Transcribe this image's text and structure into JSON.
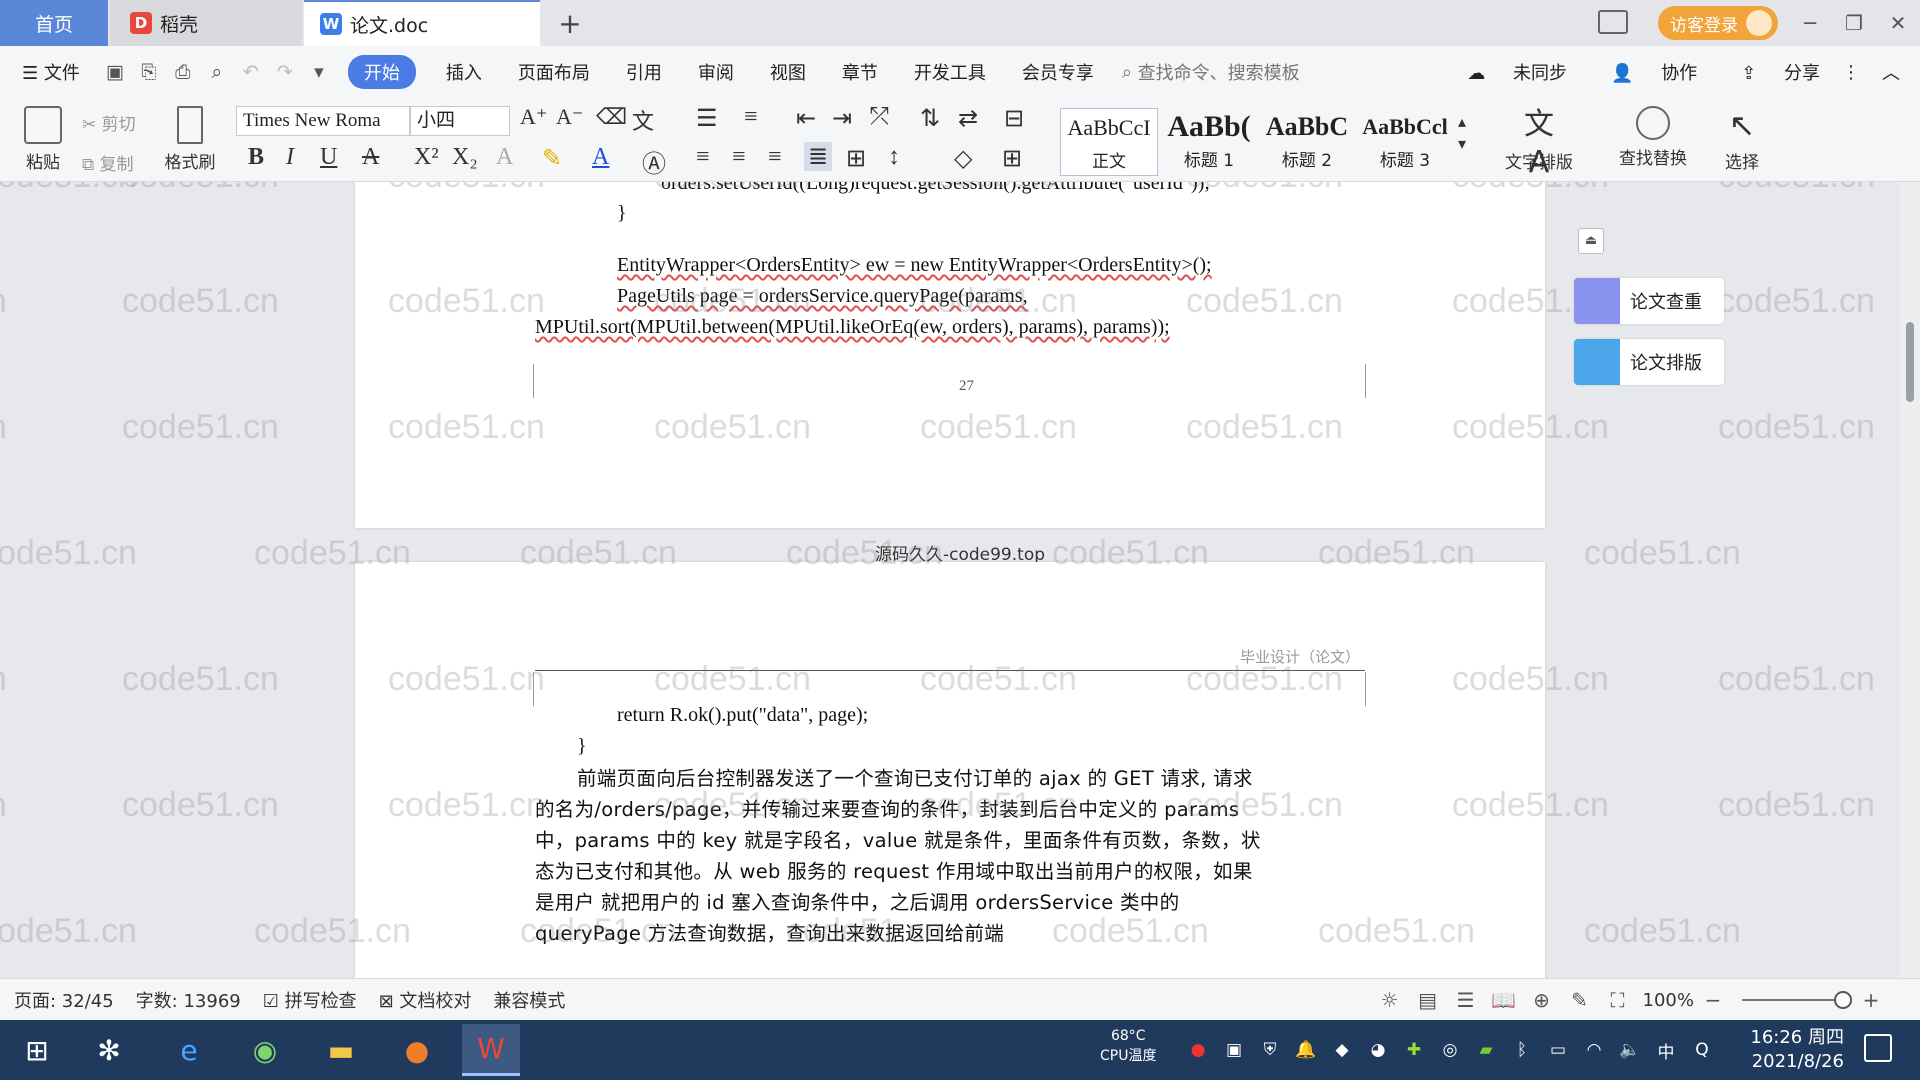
{
  "tabs": {
    "home": "首页",
    "daoke": "稻壳",
    "doc": "论文.doc",
    "plus": "+"
  },
  "login": "访客登录",
  "menu": {
    "file": "文件",
    "items": [
      "开始",
      "插入",
      "页面布局",
      "引用",
      "审阅",
      "视图",
      "章节",
      "开发工具",
      "会员专享"
    ],
    "search_placeholder": "查找命令、搜索模板",
    "sync": "未同步",
    "collab": "协作",
    "share": "分享"
  },
  "ribbon": {
    "paste": "粘贴",
    "cut": "剪切",
    "copy": "复制",
    "format_painter": "格式刷",
    "font_name": "Times New Roma",
    "font_size": "小四",
    "styles": [
      {
        "sample": "AaBbCcI",
        "label": "正文"
      },
      {
        "sample": "AaBb(",
        "label": "标题 1"
      },
      {
        "sample": "AaBbC",
        "label": "标题 2"
      },
      {
        "sample": "AaBbCcl",
        "label": "标题 3"
      }
    ],
    "text_layout": "文字排版",
    "find_replace": "查找替换",
    "select": "选择"
  },
  "page1": {
    "line0": "orders.setUserId((Long)request.getSession().getAttribute(\"userId\"));",
    "line1": "}",
    "line2": "EntityWrapper<OrdersEntity> ew = new EntityWrapper<OrdersEntity>();",
    "line3": "PageUtils page = ordersService.queryPage(params,",
    "line4": "MPUtil.sort(MPUtil.between(MPUtil.likeOrEq(ew, orders), params), params));",
    "page_number": "27"
  },
  "gap_label": "源码久久-code99.top",
  "page2": {
    "header": "毕业设计（论文）",
    "line1": "return R.ok().put(\"data\", page);",
    "line2": "}",
    "para": [
      "前端页面向后台控制器发送了一个查询已支付订单的 ajax 的 GET 请求, 请求",
      "的名为/orders/page，并传输过来要查询的条件，封装到后台中定义的 params",
      "中，params 中的 key 就是字段名，value 就是条件，里面条件有页数，条数，状",
      "态为已支付和其他。从 web 服务的 request 作用域中取出当前用户的权限，如果",
      "是用户  就把用户的 id 塞入查询条件中，之后调用 ordersService 类中的",
      "queryPage 方法查询数据，查询出来数据返回给前端"
    ]
  },
  "right_panel": {
    "check": "论文查重",
    "format": "论文排版"
  },
  "watermark": "code51.cn",
  "status": {
    "page": "页面: 32/45",
    "words": "字数: 13969",
    "spell": "拼写检查",
    "proof": "文档校对",
    "compat": "兼容模式",
    "zoom": "100%"
  },
  "taskbar": {
    "cpu_temp": "68°C",
    "cpu_label": "CPU温度",
    "time": "16:26 周四",
    "date": "2021/8/26",
    "ime": "中"
  }
}
